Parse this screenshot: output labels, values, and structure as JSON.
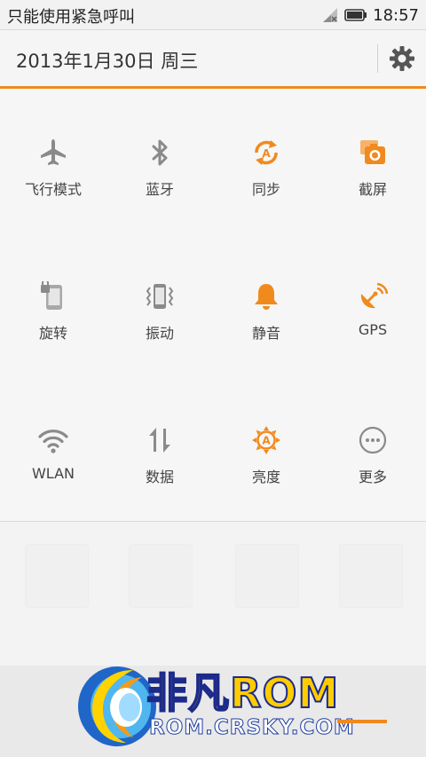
{
  "statusbar": {
    "notice": "只能使用紧急呼叫",
    "time": "18:57",
    "signal_icon": "signal-icon",
    "battery_icon": "battery-icon"
  },
  "header": {
    "date": "2013年1月30日 周三",
    "settings_icon": "gear-icon"
  },
  "toggles": [
    {
      "label": "飞行模式",
      "icon": "airplane-icon",
      "active": false
    },
    {
      "label": "蓝牙",
      "icon": "bluetooth-icon",
      "active": false
    },
    {
      "label": "同步",
      "icon": "sync-icon",
      "active": true
    },
    {
      "label": "截屏",
      "icon": "screenshot-icon",
      "active": true
    },
    {
      "label": "旋转",
      "icon": "rotate-lock-icon",
      "active": false
    },
    {
      "label": "振动",
      "icon": "vibrate-icon",
      "active": false
    },
    {
      "label": "静音",
      "icon": "bell-icon",
      "active": true
    },
    {
      "label": "GPS",
      "icon": "gps-icon",
      "active": true
    },
    {
      "label": "WLAN",
      "icon": "wifi-icon",
      "active": false
    },
    {
      "label": "数据",
      "icon": "data-icon",
      "active": false
    },
    {
      "label": "亮度",
      "icon": "brightness-icon",
      "active": true
    },
    {
      "label": "更多",
      "icon": "more-icon",
      "active": false
    }
  ],
  "watermark": {
    "title": "非凡ROM",
    "subtitle": "ROM.CRSKY.COM"
  },
  "colors": {
    "accent": "#f08a1d",
    "inactive_icon": "#8a8a8a",
    "active_icon": "#f08a1d"
  }
}
